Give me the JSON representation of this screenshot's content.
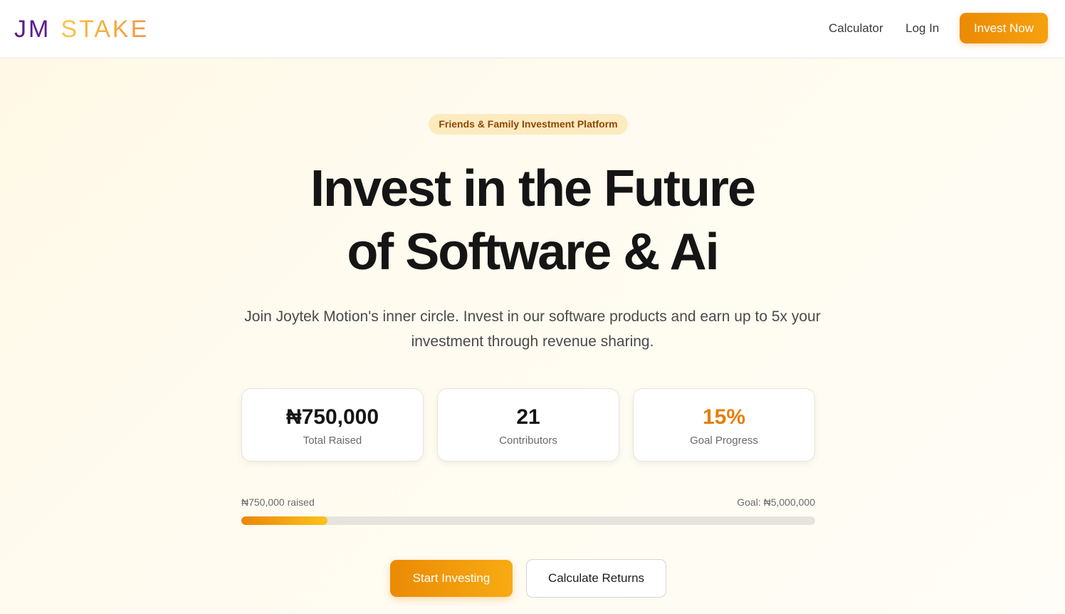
{
  "brand": {
    "logo_part1": "JM",
    "logo_part2": "STAKE",
    "logo_color_primary": "#5a1b91",
    "logo_color_secondary": "#f4b73b"
  },
  "nav": {
    "calculator": "Calculator",
    "login": "Log In",
    "invest_now": "Invest Now",
    "accent_color": "#eb8a05"
  },
  "hero": {
    "badge": "Friends & Family Investment Platform",
    "headline_line1": "Invest in the Future",
    "headline_line2": "of Software & Ai",
    "subtext": "Join Joytek Motion's inner circle. Invest in our software products and earn up to 5x your investment through revenue sharing."
  },
  "stats": [
    {
      "value": "₦750,000",
      "label": "Total Raised"
    },
    {
      "value": "21",
      "label": "Contributors"
    },
    {
      "value": "15%",
      "label": "Goal Progress"
    }
  ],
  "progress": {
    "raised_text": "₦750,000 raised",
    "goal_text": "Goal: ₦5,000,000",
    "percent": 15
  },
  "cta": {
    "primary": "Start Investing",
    "secondary": "Calculate Returns"
  }
}
